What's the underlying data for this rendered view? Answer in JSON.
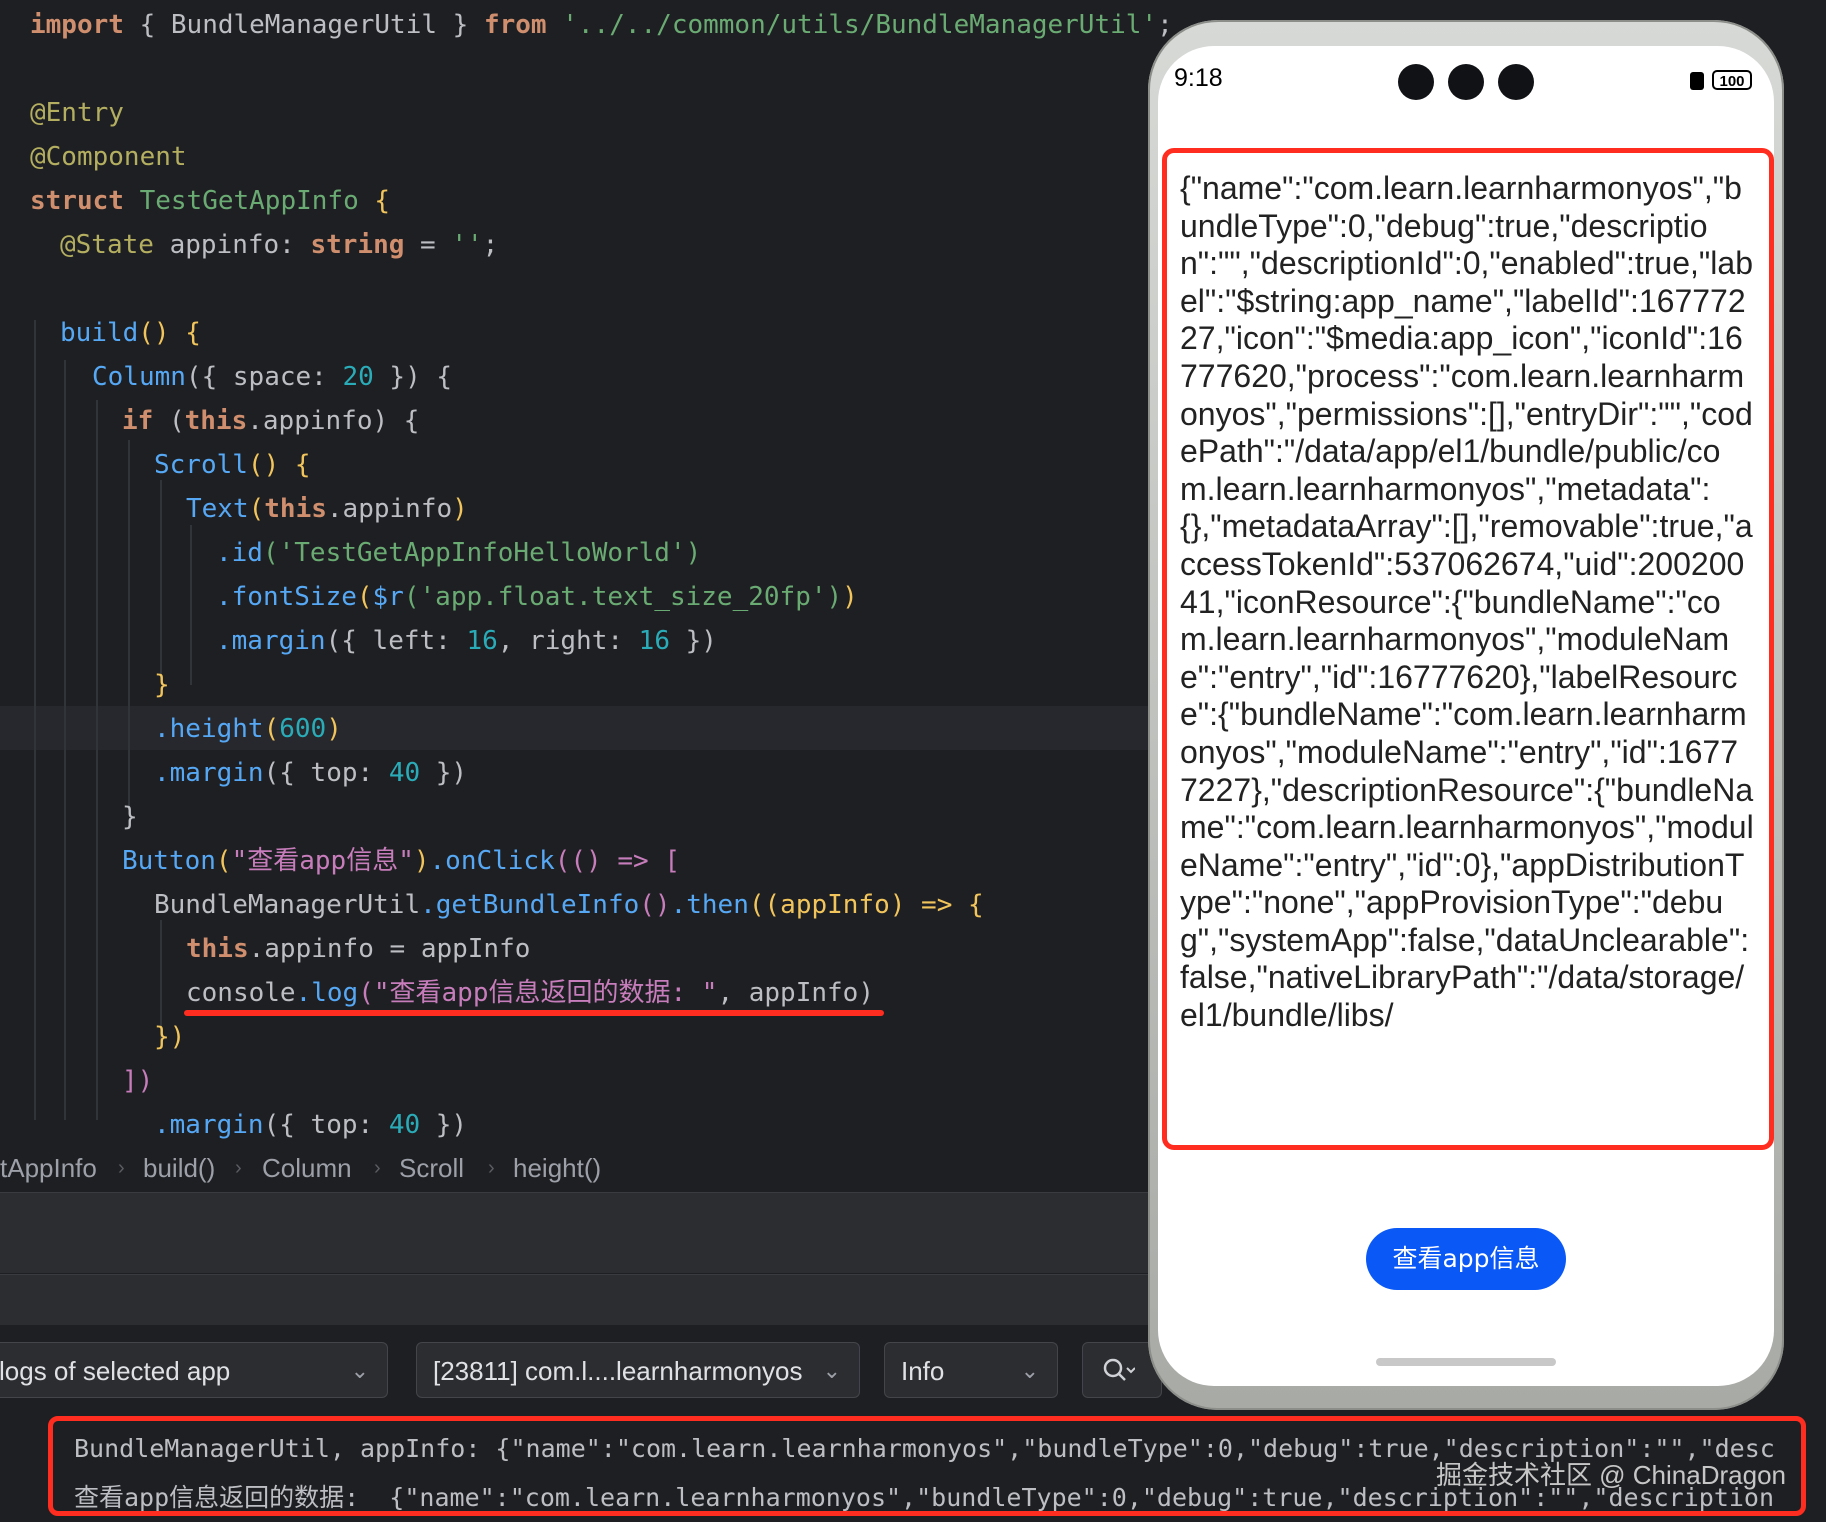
{
  "editor": {
    "code": {
      "import_kw": "import",
      "import_open": " { ",
      "import_name": "BundleManagerUtil",
      "import_close": " } ",
      "from_kw": "from",
      "import_path": " '../../common/utils/BundleManagerUtil'",
      "import_semi": ";",
      "entry": "@Entry",
      "component": "@Component",
      "struct_kw": "struct",
      "struct_name": " TestGetAppInfo",
      "struct_brace": " {",
      "state": "@State",
      "appinfo": " appinfo",
      "colon": ": ",
      "string_type": "string",
      "assign": " = ",
      "empty_str": "''",
      "semi": ";",
      "build": "build",
      "build_rest": "() {",
      "column": "Column",
      "column_rest1": "({ space: ",
      "column_space": "20",
      "column_rest2": " }) {",
      "if_kw": "if",
      "if_open": " (",
      "if_this": "this",
      "if_prop": ".appinfo",
      "if_close": ") {",
      "scroll": "Scroll",
      "scroll_rest": "() {",
      "text_fn": "Text",
      "text_open": "(",
      "text_this": "this",
      "text_prop": ".appinfo",
      "text_close": ")",
      "id_method": ".id",
      "id_arg": "('TestGetAppInfoHelloWorld')",
      "fontsize_method": ".fontSize",
      "fontsize_open": "(",
      "fontsize_r": "$r",
      "fontsize_arg": "('app.float.text_size_20fp')",
      "fontsize_close": ")",
      "margin_method": ".margin",
      "margin_rest1": "({ left: ",
      "margin_left": "16",
      "margin_rest2": ", right: ",
      "margin_right": "16",
      "margin_rest3": " })",
      "close_brace": "}",
      "height_method": ".height",
      "height_open": "(",
      "height_val": "600",
      "height_close": ")",
      "margin_top_rest1": "({ top: ",
      "margin_top_val": "40",
      "margin_top_rest2": " })",
      "button_fn": "Button",
      "button_open": "(",
      "button_label": "\"查看app信息\"",
      "button_close": ")",
      "onclick_method": ".onClick",
      "onclick_rest": "(() => [",
      "bmu": "BundleManagerUtil",
      "getinfo_method": ".getBundleInfo",
      "getinfo_rest": "()",
      "then_method": ".then",
      "then_rest": "((appInfo) => {",
      "assign_this": "this",
      "assign_prop": ".appinfo",
      "assign_rest": " = appInfo",
      "console": "console",
      "log_method": ".log",
      "log_open": "(",
      "log_str": "\"查看app信息返回的数据: \"",
      "log_rest": ", appInfo)",
      "close_then": "})",
      "close_onclick": "])",
      "margin_top2_val": "40"
    },
    "breadcrumb": [
      "tAppInfo",
      "build()",
      "Column",
      "Scroll",
      "height()"
    ]
  },
  "toolbar": {
    "log_filter": "logs of selected app",
    "process": "[23811] com.l....learnharmonyos",
    "level": "Info",
    "search_icon": "search-icon"
  },
  "logs": {
    "line1": "BundleManagerUtil, appInfo: {\"name\":\"com.learn.learnharmonyos\",\"bundleType\":0,\"debug\":true,\"description\":\"\",\"desc",
    "line2": "查看app信息返回的数据:  {\"name\":\"com.learn.learnharmonyos\",\"bundleType\":0,\"debug\":true,\"description\":\"\",\"description"
  },
  "watermark": "掘金技术社区 @ ChinaDragon",
  "phone": {
    "time": "9:18",
    "battery": "100",
    "info_text": "{\"name\":\"com.learn.learnharmonyos\",\"bundleType\":0,\"debug\":true,\"description\":\"\",\"descriptionId\":0,\"enabled\":true,\"label\":\"$string:app_name\",\"labelId\":16777227,\"icon\":\"$media:app_icon\",\"iconId\":16777620,\"process\":\"com.learn.learnharmonyos\",\"permissions\":[],\"entryDir\":\"\",\"codePath\":\"/data/app/el1/bundle/public/com.learn.learnharmonyos\",\"metadata\":{},\"metadataArray\":[],\"removable\":true,\"accessTokenId\":537062674,\"uid\":20020041,\"iconResource\":{\"bundleName\":\"com.learn.learnharmonyos\",\"moduleName\":\"entry\",\"id\":16777620},\"labelResource\":{\"bundleName\":\"com.learn.learnharmonyos\",\"moduleName\":\"entry\",\"id\":16777227},\"descriptionResource\":{\"bundleName\":\"com.learn.learnharmonyos\",\"moduleName\":\"entry\",\"id\":0},\"appDistributionType\":\"none\",\"appProvisionType\":\"debug\",\"systemApp\":false,\"dataUnclearable\":false,\"nativeLibraryPath\":\"/data/storage/el1/bundle/libs/",
    "button_label": "查看app信息"
  }
}
